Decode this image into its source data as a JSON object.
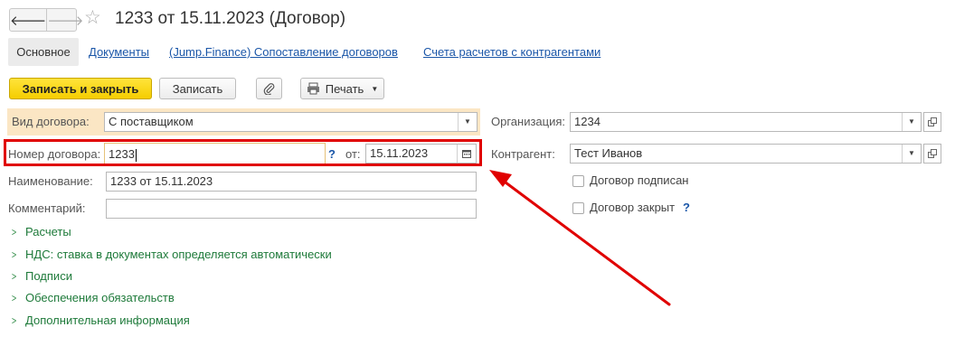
{
  "header": {
    "title": "1233 от 15.11.2023 (Договор)",
    "back_icon": "arrow-left-icon",
    "forward_icon": "arrow-right-icon",
    "favorite_icon": "star-icon"
  },
  "tabs": [
    "Основное",
    "Документы",
    "(Jump.Finance) Сопоставление договоров",
    "Счета расчетов с контрагентами"
  ],
  "toolbar": {
    "save_close": "Записать и закрыть",
    "save": "Записать",
    "print": "Печать"
  },
  "form": {
    "contract_type_label": "Вид договора:",
    "contract_type_value": "С поставщиком",
    "number_label": "Номер договора:",
    "number_value": "1233",
    "help_mark": "?",
    "date_label": "от:",
    "date_value": "15.11.2023",
    "name_label": "Наименование:",
    "name_value": "1233 от 15.11.2023",
    "comment_label": "Комментарий:",
    "comment_value": "",
    "org_label": "Организация:",
    "org_value": "1234",
    "counterparty_label": "Контрагент:",
    "counterparty_value": "Тест Иванов",
    "signed_label": "Договор подписан",
    "signed_checked": false,
    "closed_label": "Договор закрыт",
    "closed_checked": false
  },
  "groups": [
    "Расчеты",
    "НДС: ставка в документах определяется автоматически",
    "Подписи",
    "Обеспечения обязательств",
    "Дополнительная информация"
  ],
  "colors": {
    "highlight": "#e00000",
    "primary_button": "#f5cd00",
    "group_text": "#1e7a3a",
    "link": "#1a56a8"
  }
}
